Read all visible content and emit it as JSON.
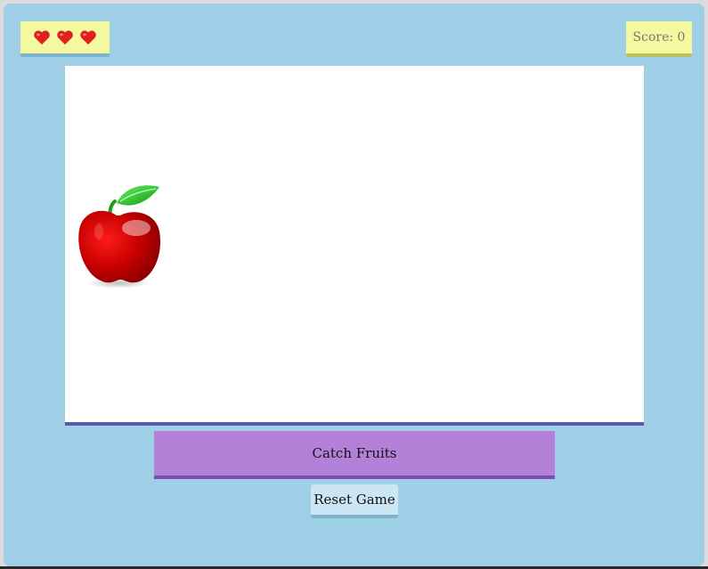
{
  "hud": {
    "lives": 3,
    "lives_icon": "heart-icon",
    "score_text": "Score: 0"
  },
  "game": {
    "falling_item_icon": "apple-icon"
  },
  "catcher": {
    "label": "Catch Fruits"
  },
  "controls": {
    "reset_label": "Reset Game"
  },
  "colors": {
    "background": "#9ecfe7",
    "hud_panel": "#f4f9a0",
    "catcher": "#b382d8",
    "heart": "#e02020"
  }
}
